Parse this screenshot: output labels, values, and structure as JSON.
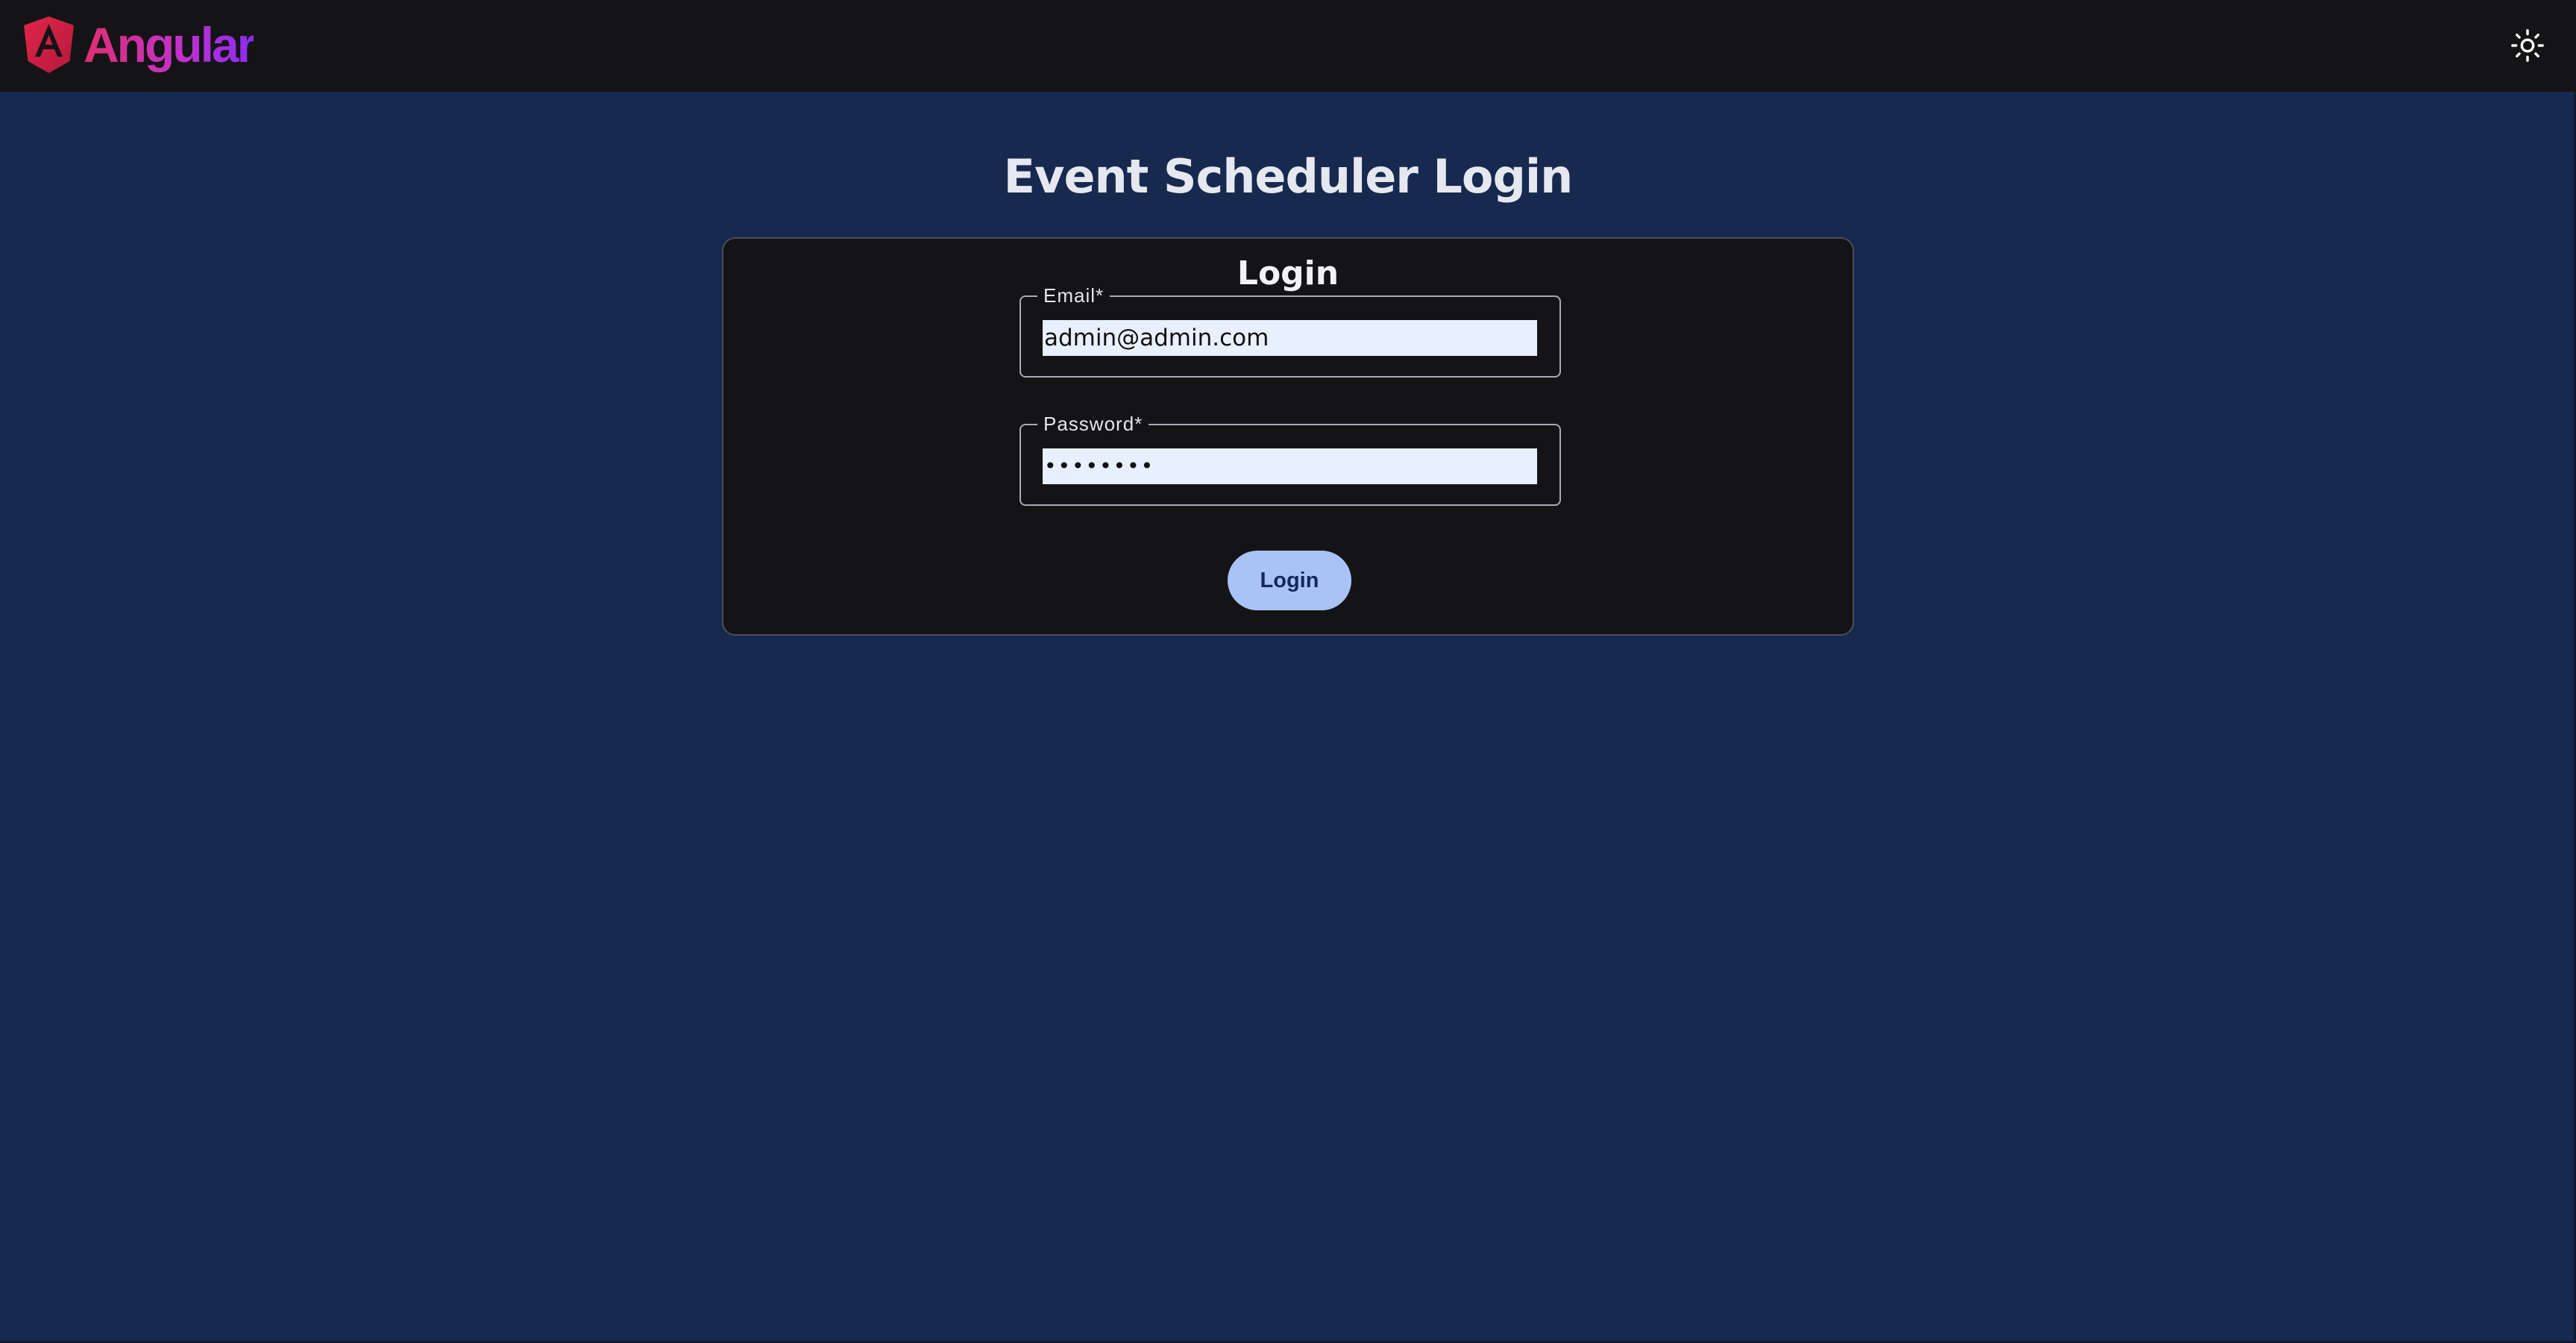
{
  "header": {
    "brand_text": "Angular",
    "theme_toggle_icon": "sun-icon",
    "brand_colors": [
      "#e02e6e",
      "#c232c9",
      "#8b2cf0"
    ]
  },
  "page": {
    "title": "Event Scheduler Login"
  },
  "login_card": {
    "title": "Login",
    "email": {
      "label": "Email*",
      "value": "admin@admin.com"
    },
    "password": {
      "label": "Password*",
      "value": "••••••••"
    },
    "submit_label": "Login"
  },
  "colors": {
    "page_background": "#17294f",
    "toolbar_background": "#141416",
    "card_background": "#141416",
    "autofill_background": "#e8f0fe",
    "primary_button": "#a9c3f7",
    "primary_button_text": "#14285a"
  }
}
